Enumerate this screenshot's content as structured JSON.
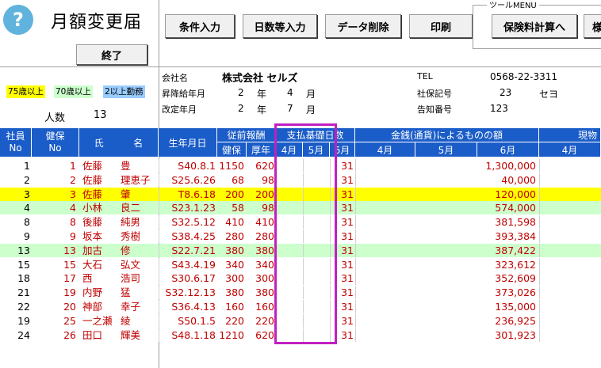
{
  "app": {
    "title": "月額変更届",
    "help_glyph": "?"
  },
  "buttons": {
    "exit": "終了",
    "cond_input": "条件入力",
    "days_input": "日数等入力",
    "data_delete": "データ削除",
    "print": "印刷",
    "premium_calc": "保険料計算へ",
    "cut_off": "様"
  },
  "tool_menu_label": "ツールMENU",
  "legend": {
    "age75": "75歳以上",
    "age70": "70歳以上",
    "multi": "2以上勤務",
    "age75_color": "#ffff00",
    "age70_color": "#ccffcc",
    "multi_color": "#99ccff"
  },
  "summary": {
    "count_label": "人数",
    "count_value": "13"
  },
  "company": {
    "name_label": "会社名",
    "name_value": "株式会社 セルズ",
    "raise_label": "昇降給年月",
    "raise_year": "2",
    "raise_month": "4",
    "revise_label": "改定年月",
    "revise_year": "2",
    "revise_month": "7",
    "year_unit": "年",
    "month_unit": "月",
    "tel_label": "TEL",
    "tel_value": "0568-22-3311",
    "social_label": "社保記号",
    "social_num": "23",
    "social_kana": "セヨ",
    "notice_label": "告知番号",
    "notice_value": "123"
  },
  "table": {
    "headers": {
      "emp_no_1": "社員",
      "emp_no_2": "No",
      "kenpo_1": "健保",
      "kenpo_2": "No",
      "name_1": "氏",
      "name_2": "名",
      "birth": "生年月日",
      "prev_pay": "従前報酬",
      "kenpo": "健保",
      "kosei": "厚年",
      "pay_days": "支払基礎日数",
      "m4": "4月",
      "m5": "5月",
      "m6": "6月",
      "cash": "金銭(通貨)によるものの額",
      "cash_m4": "4月",
      "cash_m5": "5月",
      "cash_m6": "6月",
      "goods": "現物",
      "goods_m4": "4月"
    },
    "rows": [
      {
        "emp": "1",
        "kenpo": "1",
        "sei": "佐藤",
        "mei": "豊",
        "birth": "S40.8.1",
        "k": "1150",
        "n": "620",
        "d6": "31",
        "cash6": "1,300,000",
        "bg": "#ffffff"
      },
      {
        "emp": "2",
        "kenpo": "2",
        "sei": "佐藤",
        "mei": "理恵子",
        "birth": "S25.6.26",
        "k": "68",
        "n": "98",
        "d6": "31",
        "cash6": "40,000",
        "bg": "#ffffff"
      },
      {
        "emp": "3",
        "kenpo": "3",
        "sei": "佐藤",
        "mei": "肇",
        "birth": "T8.6.18",
        "k": "200",
        "n": "200",
        "d6": "31",
        "cash6": "120,000",
        "bg": "#ffff00"
      },
      {
        "emp": "4",
        "kenpo": "4",
        "sei": "小林",
        "mei": "良二",
        "birth": "S23.1.23",
        "k": "58",
        "n": "98",
        "d6": "31",
        "cash6": "574,000",
        "bg": "#ccffcc"
      },
      {
        "emp": "8",
        "kenpo": "8",
        "sei": "後藤",
        "mei": "純男",
        "birth": "S32.5.12",
        "k": "410",
        "n": "410",
        "d6": "31",
        "cash6": "381,598",
        "bg": "#ffffff"
      },
      {
        "emp": "9",
        "kenpo": "9",
        "sei": "坂本",
        "mei": "秀樹",
        "birth": "S38.4.25",
        "k": "280",
        "n": "280",
        "d6": "31",
        "cash6": "393,384",
        "bg": "#ffffff"
      },
      {
        "emp": "13",
        "kenpo": "13",
        "sei": "加古",
        "mei": "修",
        "birth": "S22.7.21",
        "k": "380",
        "n": "380",
        "d6": "31",
        "cash6": "387,422",
        "bg": "#ccffcc"
      },
      {
        "emp": "15",
        "kenpo": "15",
        "sei": "大石",
        "mei": "弘文",
        "birth": "S43.4.19",
        "k": "340",
        "n": "340",
        "d6": "31",
        "cash6": "323,612",
        "bg": "#ffffff"
      },
      {
        "emp": "18",
        "kenpo": "17",
        "sei": "西",
        "mei": "浩司",
        "birth": "S30.6.17",
        "k": "300",
        "n": "300",
        "d6": "31",
        "cash6": "352,609",
        "bg": "#ffffff"
      },
      {
        "emp": "21",
        "kenpo": "19",
        "sei": "内野",
        "mei": "猛",
        "birth": "S32.12.13",
        "k": "380",
        "n": "380",
        "d6": "31",
        "cash6": "373,026",
        "bg": "#ffffff"
      },
      {
        "emp": "22",
        "kenpo": "20",
        "sei": "神部",
        "mei": "幸子",
        "birth": "S36.4.13",
        "k": "160",
        "n": "160",
        "d6": "31",
        "cash6": "135,000",
        "bg": "#ffffff"
      },
      {
        "emp": "19",
        "kenpo": "25",
        "sei": "一之瀬",
        "mei": "綾",
        "birth": "S50.1.5",
        "k": "220",
        "n": "220",
        "d6": "31",
        "cash6": "236,925",
        "bg": "#ffffff"
      },
      {
        "emp": "24",
        "kenpo": "26",
        "sei": "田口",
        "mei": "輝美",
        "birth": "S48.1.18",
        "k": "1210",
        "n": "620",
        "d6": "31",
        "cash6": "301,923",
        "bg": "#ffffff"
      }
    ]
  }
}
